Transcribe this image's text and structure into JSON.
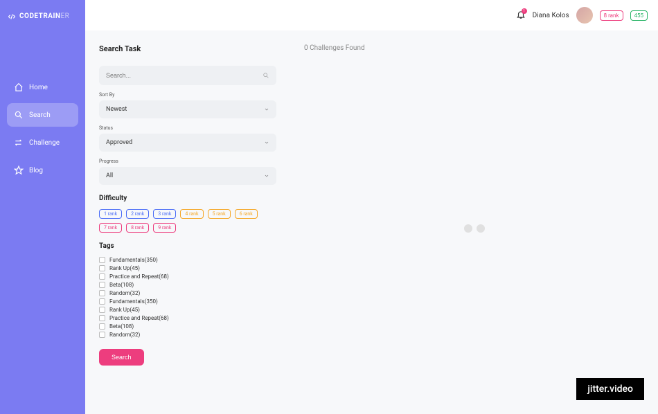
{
  "brand": {
    "main": "CODETRAIN",
    "suffix": "ER"
  },
  "nav": {
    "items": [
      {
        "label": "Home"
      },
      {
        "label": "Search"
      },
      {
        "label": "Challenge"
      },
      {
        "label": "Blog"
      }
    ]
  },
  "header": {
    "notif_count": "1",
    "username": "Diana Kolos",
    "rank_badge": "8 rank",
    "score_badge": "455"
  },
  "search": {
    "title": "Search Task",
    "placeholder": "Search...",
    "sort_label": "Sort By",
    "sort_value": "Newest",
    "status_label": "Status",
    "status_value": "Approved",
    "progress_label": "Progress",
    "progress_value": "All",
    "difficulty_title": "Difficulty",
    "ranks": [
      {
        "label": "1 rank",
        "cls": "blue"
      },
      {
        "label": "2 rank",
        "cls": "blue"
      },
      {
        "label": "3 rank",
        "cls": "blue"
      },
      {
        "label": "4 rank",
        "cls": "orange"
      },
      {
        "label": "5 rank",
        "cls": "orange"
      },
      {
        "label": "6 rank",
        "cls": "orange"
      },
      {
        "label": "7 rank",
        "cls": "red"
      },
      {
        "label": "8 rank",
        "cls": "red"
      },
      {
        "label": "9 rank",
        "cls": "red"
      }
    ],
    "tags_title": "Tags",
    "tags": [
      "Fundamentals(350)",
      "Rank Up(45)",
      "Practice and Repeat(68)",
      "Beta(108)",
      "Random(32)",
      "Fundamentals(350)",
      "Rank Up(45)",
      "Practice and Repeat(68)",
      "Beta(108)",
      "Random(32)"
    ],
    "button": "Search"
  },
  "results": {
    "header": "0 Challenges Found"
  },
  "watermark": "jitter.video"
}
